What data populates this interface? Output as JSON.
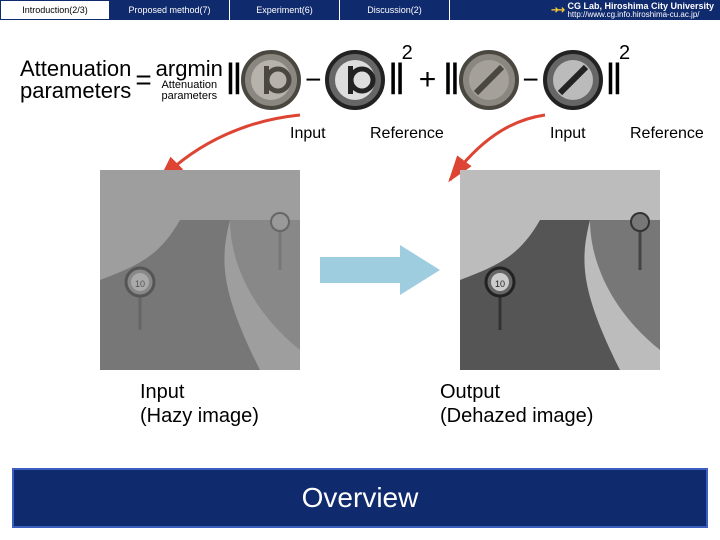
{
  "tabs": {
    "t1": "Introduction(2/3)",
    "t2": "Proposed method(7)",
    "t3": "Experiment(6)",
    "t4": "Discussion(2)"
  },
  "lab": {
    "uni": "CG Lab, Hiroshima City University",
    "url": "http://www.cg.info.hiroshima-cu.ac.jp/"
  },
  "formula": {
    "lhs_top": "Attenuation",
    "lhs_bot": "parameters",
    "eq": "=",
    "argmin": "argmin",
    "sub_top": "Attenuation",
    "sub_bot": "parameters",
    "minus": "−",
    "plus": "+",
    "exp": "2"
  },
  "under": {
    "input": "Input",
    "reference": "Reference"
  },
  "img_labels": {
    "left_top": "Input",
    "left_bot": "(Hazy image)",
    "right_top": "Output",
    "right_bot": "(Dehazed image)"
  },
  "footer": "Overview"
}
